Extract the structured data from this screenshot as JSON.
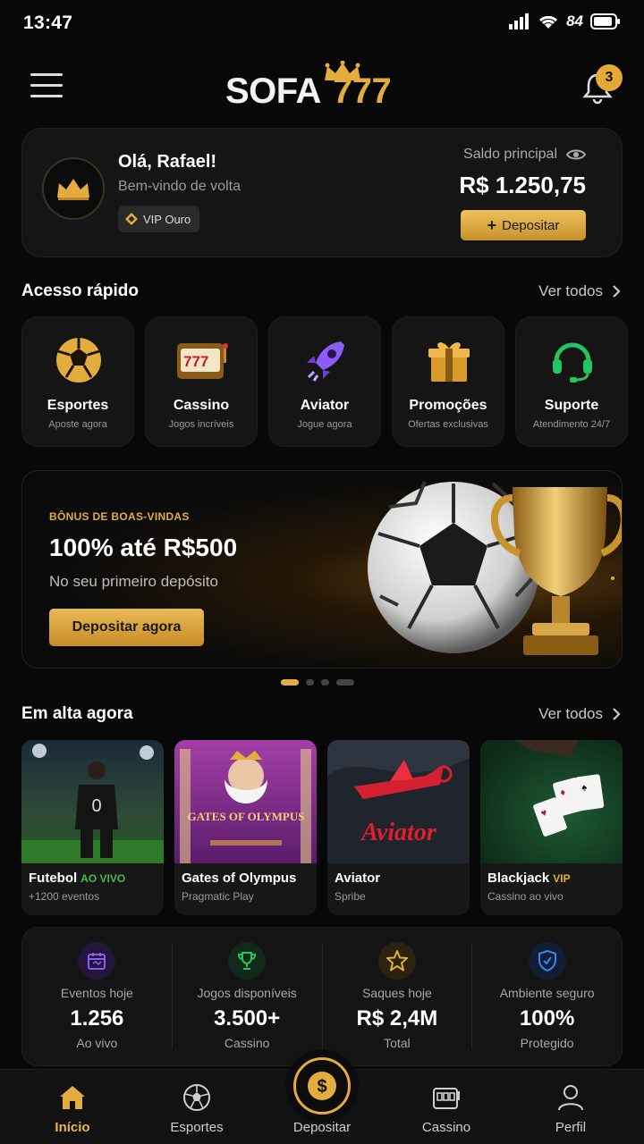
{
  "status_bar": {
    "time": "13:47",
    "battery": "84"
  },
  "header": {
    "logo_main": "SOFA",
    "logo_accent": "777",
    "notification_count": "3"
  },
  "user": {
    "greeting": "Olá, Rafael!",
    "welcome": "Bem-vindo de volta",
    "vip_level": "VIP Ouro",
    "balance_label": "Saldo principal",
    "balance": "R$ 1.250,75",
    "deposit_label": "Depositar"
  },
  "quick_access": {
    "title": "Acesso rápido",
    "see_all": "Ver todos",
    "items": [
      {
        "icon": "soccer-ball-icon",
        "label": "Esportes",
        "sub": "Aposte agora"
      },
      {
        "icon": "slot-machine-icon",
        "label": "Cassino",
        "sub": "Jogos incríveis"
      },
      {
        "icon": "rocket-icon",
        "label": "Aviator",
        "sub": "Jogue agora"
      },
      {
        "icon": "gift-icon",
        "label": "Promoções",
        "sub": "Ofertas exclusivas"
      },
      {
        "icon": "headset-icon",
        "label": "Suporte",
        "sub": "Atendimento 24/7"
      }
    ]
  },
  "banner": {
    "kicker": "BÔNUS DE BOAS-VINDAS",
    "title": "100% até R$500",
    "subtitle": "No seu primeiro depósito",
    "cta": "Depositar agora",
    "slides": 4,
    "active_slide": 1
  },
  "trending": {
    "title": "Em alta agora",
    "see_all": "Ver todos",
    "items": [
      {
        "title": "Futebol",
        "tag": "AO VIVO",
        "tag_color": "#3fbf4a",
        "sub": "+1200 eventos"
      },
      {
        "title": "Gates of Olympus",
        "tag": "",
        "tag_color": "",
        "sub": "Pragmatic Play",
        "art_text": "GATES OF OLYMPUS"
      },
      {
        "title": "Aviator",
        "tag": "",
        "tag_color": "",
        "sub": "Spribe",
        "art_text": "Aviator"
      },
      {
        "title": "Blackjack",
        "tag": "VIP",
        "tag_color": "#e2ad3c",
        "sub": "Cassino ao vivo"
      }
    ]
  },
  "stats": [
    {
      "icon": "calendar-icon",
      "color": "#8b5cf6",
      "label": "Eventos hoje",
      "value": "1.256",
      "sub": "Ao vivo"
    },
    {
      "icon": "trophy-icon",
      "color": "#22c55e",
      "label": "Jogos disponíveis",
      "value": "3.500+",
      "sub": "Cassino"
    },
    {
      "icon": "star-icon",
      "color": "#e2ad3c",
      "label": "Saques hoje",
      "value": "R$ 2,4M",
      "sub": "Total"
    },
    {
      "icon": "shield-icon",
      "color": "#3b82f6",
      "label": "Ambiente seguro",
      "value": "100%",
      "sub": "Protegido"
    }
  ],
  "bottom_nav": {
    "items": [
      {
        "label": "Início",
        "icon": "home-icon",
        "active": true
      },
      {
        "label": "Esportes",
        "icon": "soccer-ball-icon",
        "active": false
      },
      {
        "label": "Depositar",
        "icon": "dollar-coin-icon",
        "active": false
      },
      {
        "label": "Cassino",
        "icon": "slot-machine-icon",
        "active": false
      },
      {
        "label": "Perfil",
        "icon": "user-icon",
        "active": false
      }
    ]
  },
  "colors": {
    "accent": "#e2ad3c",
    "background": "#080808",
    "card": "#151515"
  }
}
